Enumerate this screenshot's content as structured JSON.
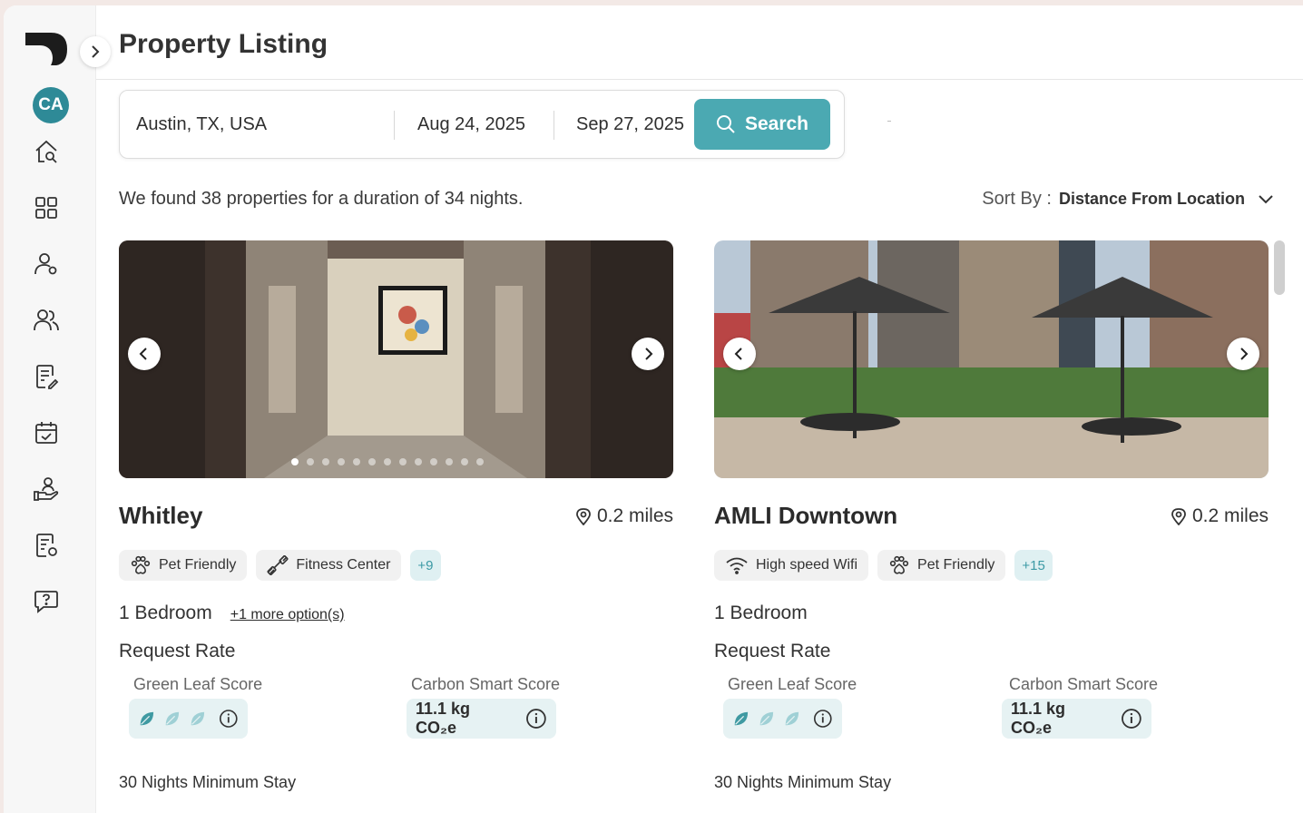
{
  "page": {
    "title": "Property Listing"
  },
  "sidebar": {
    "avatar_initials": "CA",
    "items": [
      {
        "icon": "home-search-icon"
      },
      {
        "icon": "dashboard-grid-icon"
      },
      {
        "icon": "user-settings-icon"
      },
      {
        "icon": "users-icon"
      },
      {
        "icon": "document-edit-icon"
      },
      {
        "icon": "calendar-check-icon"
      },
      {
        "icon": "hand-user-icon"
      },
      {
        "icon": "document-settings-icon"
      },
      {
        "icon": "chat-help-icon"
      }
    ]
  },
  "search": {
    "location": "Austin, TX, USA",
    "check_in": "Aug 24, 2025",
    "check_out": "Sep 27, 2025",
    "button_label": "Search"
  },
  "results": {
    "summary": "We found 38 properties for a duration of 34 nights.",
    "sort_label": "Sort By :",
    "sort_value": "Distance From Location"
  },
  "colors": {
    "accent": "#4ba9b2",
    "avatar": "#2e8a97",
    "score_bg": "#e6f2f3"
  },
  "cards": [
    {
      "name": "Whitley",
      "distance": "0.2 miles",
      "amenities": [
        {
          "label": "Pet Friendly",
          "icon": "paw-icon"
        },
        {
          "label": "Fitness Center",
          "icon": "dumbbell-icon"
        }
      ],
      "more_amenities": "+9",
      "bedroom": "1 Bedroom",
      "more_options": "+1 more option(s)",
      "rate_label": "Request Rate",
      "green_leaf_label": "Green Leaf Score",
      "green_leaf_score": 1,
      "green_leaf_max": 3,
      "carbon_label": "Carbon Smart Score",
      "carbon_value": "11.1 kg CO₂e",
      "min_stay": "30 Nights Minimum Stay"
    },
    {
      "name": "AMLI Downtown",
      "distance": "0.2 miles",
      "amenities": [
        {
          "label": "High speed Wifi",
          "icon": "wifi-icon"
        },
        {
          "label": "Pet Friendly",
          "icon": "paw-icon"
        }
      ],
      "more_amenities": "+15",
      "bedroom": "1 Bedroom",
      "more_options": "",
      "rate_label": "Request Rate",
      "green_leaf_label": "Green Leaf Score",
      "green_leaf_score": 1,
      "green_leaf_max": 3,
      "carbon_label": "Carbon Smart Score",
      "carbon_value": "11.1 kg CO₂e",
      "min_stay": "30 Nights Minimum Stay"
    }
  ]
}
